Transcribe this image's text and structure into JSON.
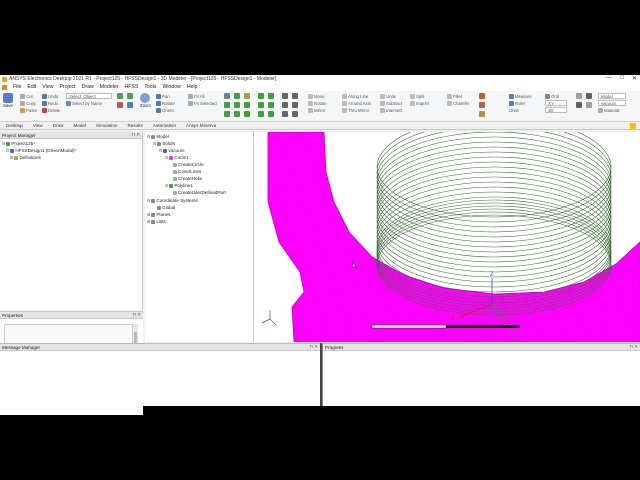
{
  "window": {
    "title": "ANSYS Electronics Desktop 2021 R1 - Project125 - HFSSDesign1 - 3D Modeler - [Project125 - HFSSDesign1 - Modeler]",
    "controls": [
      "—",
      "□",
      "✕"
    ]
  },
  "menu": [
    "File",
    "Edit",
    "View",
    "Project",
    "Draw",
    "Modeler",
    "HFSS",
    "Tools",
    "Window",
    "Help"
  ],
  "ribbon": {
    "save": "Save",
    "clipboard": [
      "Cut",
      "Copy",
      "Paste"
    ],
    "history": [
      "Undo",
      "Redo",
      "Delete"
    ],
    "select": [
      "Select: Object",
      "Select by Name"
    ],
    "zoom": "Zoom",
    "view": [
      "Pan",
      "Rotate",
      "Orient"
    ],
    "fit": [
      "Fit All",
      "Fit Selected"
    ],
    "edit": [
      "Move",
      "Rotate",
      "Mirror"
    ],
    "along": [
      "Along Line",
      "Around Axis",
      "Thru Mirror"
    ],
    "boolean": [
      "Unite",
      "Subtract",
      "Intersect"
    ],
    "split": [
      "Split",
      "Imprint"
    ],
    "fillet": [
      "Fillet",
      "Chamfer"
    ],
    "measure": [
      "Measure",
      "Ruler",
      "Units"
    ],
    "grid": [
      "Grid",
      "XY",
      "3D"
    ],
    "model": [
      "Model",
      "vacuum",
      "Material"
    ]
  },
  "tabs": [
    "Desktop",
    "View",
    "Draw",
    "Model",
    "Simulation",
    "Results",
    "Automation",
    "Ansys Minerva"
  ],
  "project_manager": {
    "title": "Project Manager",
    "items": [
      "Project125*",
      "HFSSDesign1 (DrivenModal)*",
      "Definitions"
    ]
  },
  "model_tree": {
    "items": [
      "Model",
      "Solids",
      "vacuum",
      "Circle1",
      "CreateCircle",
      "CoverLines",
      "CreateHelix",
      "Polyline1",
      "CreateUserDefinedPart",
      "Coordinate Systems",
      "Global",
      "Planes",
      "Lists"
    ]
  },
  "properties": {
    "title": "Properties"
  },
  "message_manager": {
    "title": "Message Manager"
  },
  "progress": {
    "title": "Progress"
  },
  "axes": {
    "x": "X",
    "y": "Y",
    "z": "Z"
  },
  "colors": {
    "accent": "#ff00ff",
    "helix": "#3a6b34",
    "ribbon_bg": "#f5f6f7"
  }
}
